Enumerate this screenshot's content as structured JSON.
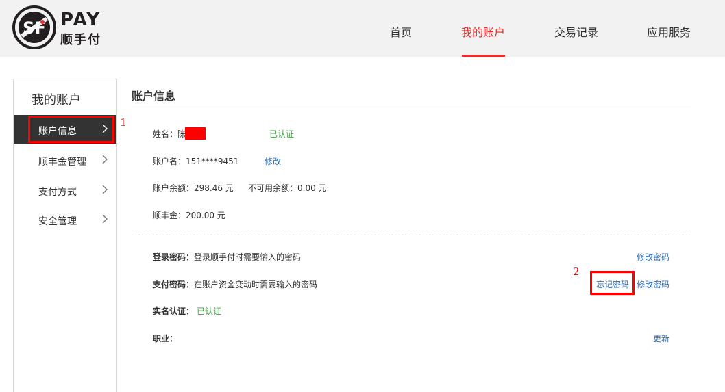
{
  "header": {
    "logo": {
      "mark": "SF",
      "text": "PAY",
      "cn": "顺手付"
    },
    "nav": [
      {
        "label": "首页"
      },
      {
        "label": "我的账户",
        "active": true
      },
      {
        "label": "交易记录"
      },
      {
        "label": "应用服务"
      }
    ]
  },
  "sidebar": {
    "title": "我的账户",
    "items": [
      {
        "label": "账户信息",
        "active": true
      },
      {
        "label": "顺丰金管理"
      },
      {
        "label": "支付方式"
      },
      {
        "label": "安全管理"
      }
    ]
  },
  "annotations": {
    "one": "1",
    "two": "2"
  },
  "main": {
    "title": "账户信息",
    "name_label": "姓名：陈",
    "verified": "已认证",
    "account_name": "账户名：151****9451",
    "modify": "修改",
    "balance": "账户余额：298.46 元",
    "unavailable": "不可用余额：0.00 元",
    "sf_gold": "顺丰金：200.00 元",
    "security": {
      "login_label": "登录密码：",
      "login_desc": "登录顺手付时需要输入的密码",
      "login_action": "修改密码",
      "pay_label": "支付密码：",
      "pay_desc": "在账户资金变动时需要输入的密码",
      "forgot": "忘记密码",
      "pay_action": "修改密码",
      "realname_label": "实名认证：",
      "realname_value": "已认证",
      "job_label": "职业：",
      "job_action": "更新"
    }
  },
  "colors": {
    "accent": "#e03030",
    "link": "#2f6fb6",
    "success": "#3aa53a",
    "active_bg": "#333333",
    "annotation": "#ff0000"
  }
}
